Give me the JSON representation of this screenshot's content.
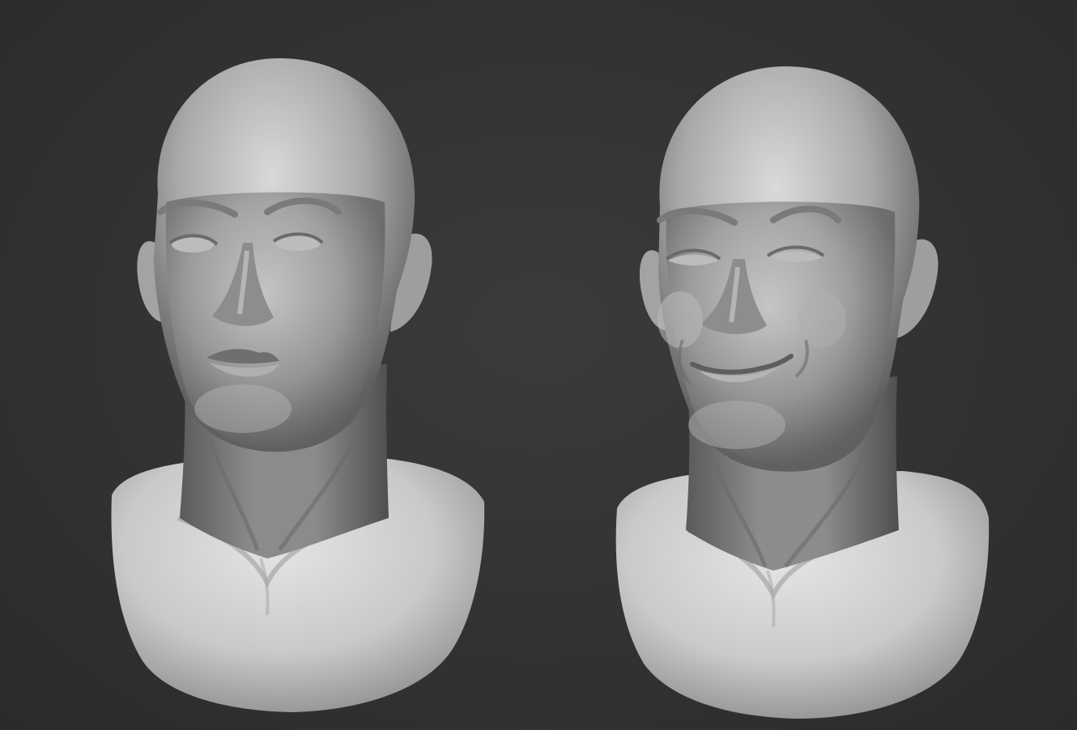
{
  "scene": {
    "background_color": "#2f3130",
    "sculpt_material_color": "#d8d8d6",
    "busts": [
      {
        "expression": "neutral"
      },
      {
        "expression": "smile"
      }
    ]
  }
}
